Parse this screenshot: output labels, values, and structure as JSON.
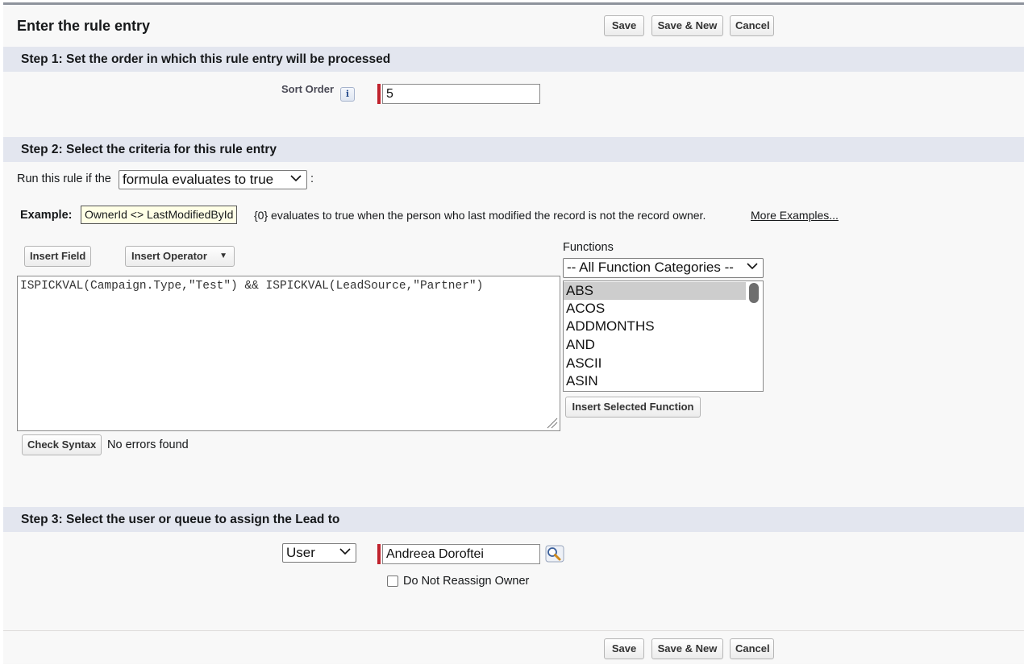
{
  "header": {
    "title": "Enter the rule entry",
    "save_label": "Save",
    "save_new_label": "Save & New",
    "cancel_label": "Cancel"
  },
  "step1": {
    "heading": "Step 1: Set the order in which this rule entry will be processed",
    "sort_order_label": "Sort Order",
    "info_glyph": "i",
    "sort_order_value": "5"
  },
  "step2": {
    "heading": "Step 2: Select the criteria for this rule entry",
    "run_rule_prefix": "Run this rule if the",
    "run_rule_selected": "formula evaluates to true",
    "run_rule_suffix": ":",
    "example_label": "Example:",
    "example_code": "OwnerId <> LastModifiedById",
    "example_desc": "{0} evaluates to true when the person who last modified the record is not the record owner.",
    "more_examples": "More Examples...",
    "insert_field_label": "Insert Field",
    "insert_operator_label": "Insert Operator",
    "insert_operator_arrow": "▼",
    "formula": "ISPICKVAL(Campaign.Type,\"Test\") && ISPICKVAL(LeadSource,\"Partner\")",
    "functions_label": "Functions",
    "function_category": "-- All Function Categories --",
    "functions": [
      "ABS",
      "ACOS",
      "ADDMONTHS",
      "AND",
      "ASCII",
      "ASIN"
    ],
    "selected_function": "ABS",
    "insert_function_label": "Insert Selected Function",
    "check_syntax_label": "Check Syntax",
    "syntax_status": "No errors found"
  },
  "step3": {
    "heading": "Step 3: Select the user or queue to assign the Lead to",
    "assignee_type": "User",
    "assignee_value": "Andreea Doroftei",
    "lookup_icon": "lookup-icon",
    "do_not_reassign_label": "Do Not Reassign Owner",
    "do_not_reassign_checked": false
  },
  "footer": {
    "save_label": "Save",
    "save_new_label": "Save & New",
    "cancel_label": "Cancel"
  },
  "colors": {
    "section_bg": "#e3e6ef",
    "required_bar": "#c0232d",
    "example_bg": "#ffffe6",
    "selected_item": "#cdcdcd"
  }
}
